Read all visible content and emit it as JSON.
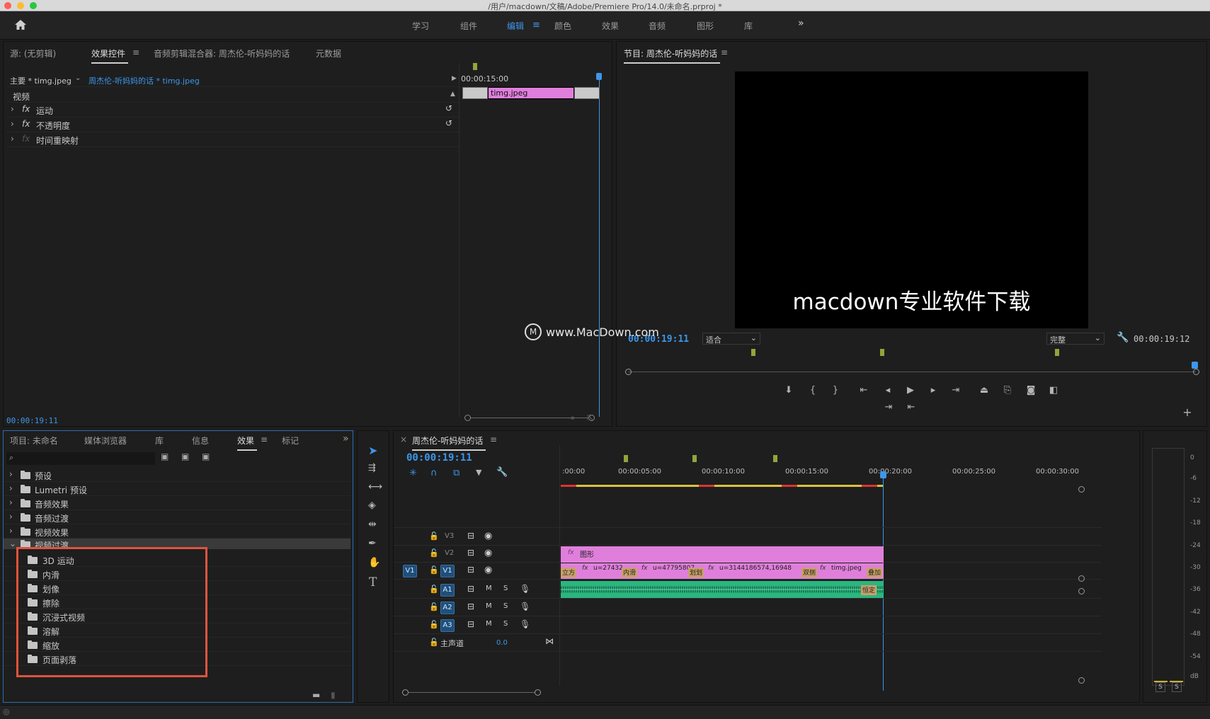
{
  "window": {
    "title": "/用户/macdown/文稿/Adobe/Premiere Pro/14.0/未命名.prproj *"
  },
  "workspaces": [
    "学习",
    "组件",
    "编辑",
    "颜色",
    "效果",
    "音频",
    "图形",
    "库"
  ],
  "workspace_active": "编辑",
  "effect_controls": {
    "tabs": [
      "源: (无剪辑)",
      "效果控件",
      "音频剪辑混合器: 周杰伦-听妈妈的话",
      "元数据"
    ],
    "active_tab": "效果控件",
    "master_label": "主要 * timg.jpeg",
    "clip_label": "周杰伦-听妈妈的话 * timg.jpeg",
    "timecode_ruler": "00:00:15:00",
    "clip_name": "timg.jpeg",
    "section": "视频",
    "properties": [
      "运动",
      "不透明度",
      "时间重映射"
    ],
    "fx": "fx",
    "timecode": "00:00:19:11"
  },
  "program": {
    "title": "节目: 周杰伦-听妈妈的话",
    "overlay_text": "macdown专业软件下载",
    "timecode_left": "00:00:19:11",
    "fit": "适合",
    "quality": "完整",
    "timecode_right": "00:00:19:12",
    "watermark": "www.MacDown.com"
  },
  "project": {
    "tabs": [
      "项目: 未命名",
      "媒体浏览器",
      "库",
      "信息",
      "效果",
      "标记"
    ],
    "active_tab": "效果",
    "folders": [
      "预设",
      "Lumetri 预设",
      "音频效果",
      "音频过渡",
      "视频效果",
      "视频过渡"
    ],
    "subfolders": [
      "3D 运动",
      "内滑",
      "划像",
      "擦除",
      "沉浸式视频",
      "溶解",
      "缩放",
      "页面剥落"
    ],
    "search_value": ""
  },
  "timeline": {
    "title": "周杰伦-听妈妈的话",
    "timecode": "00:00:19:11",
    "ruler": [
      ":00:00",
      "00:00:05:00",
      "00:00:10:00",
      "00:00:15:00",
      "00:00:20:00",
      "00:00:25:00",
      "00:00:30:00"
    ],
    "video_tracks": [
      "V3",
      "V2",
      "V1"
    ],
    "audio_tracks": [
      "A1",
      "A2",
      "A3"
    ],
    "source_patch": "V1",
    "master_label": "主声道",
    "master_value": "0.0",
    "graphic_clip": "图形",
    "v1_clips": [
      "立方",
      "u=27432",
      "内滑",
      "u=47795807",
      "划划",
      "u=3144186574,16948",
      "双侧",
      "timg.jpeg",
      "叠加"
    ],
    "audio_clip_tail": "恒定",
    "m_label": "M",
    "s_label": "S"
  },
  "meter": {
    "scale": [
      "0",
      "-6",
      "-12",
      "-18",
      "-24",
      "-30",
      "-36",
      "-42",
      "-48",
      "-54",
      "dB"
    ],
    "solo": [
      "S",
      "S"
    ]
  },
  "colors": {
    "accent": "#3d96ea",
    "clip_pink": "#e07fdb",
    "audio_green": "#2bb67f",
    "highlight_red": "#e0533f"
  }
}
